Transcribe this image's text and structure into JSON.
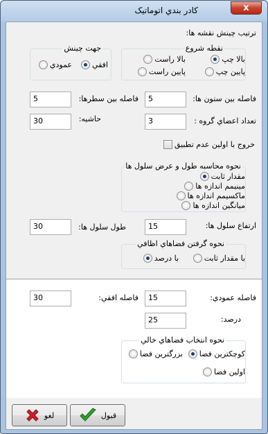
{
  "window": {
    "title": "کادر بندي اتوماتيک",
    "close_label": "x"
  },
  "grid_order": {
    "label": "ترتيب چينش نقشه ها:",
    "start_point": {
      "legend": "نقطه شروع",
      "options": [
        "بالا چپ",
        "بالا راست",
        "پايين چپ",
        "پايين راست"
      ],
      "selected": "بالا چپ"
    },
    "direction": {
      "legend": "جهت چينش",
      "options": [
        "افقي",
        "عمودي"
      ],
      "selected": "افقي"
    }
  },
  "fields": {
    "column_gap_label": "فاصله بين ستون ها:",
    "column_gap_value": "5",
    "row_gap_label": "فاصله بين سطرها:",
    "row_gap_value": "5",
    "group_members_label": "تعداد اعضاي گروه :",
    "group_members_value": "3",
    "margin_label": "حاشيه:",
    "margin_value": "30"
  },
  "exit_checkbox": {
    "label": "خروج با اولين عدم تطبيق",
    "checked": false
  },
  "cell_size": {
    "legend": "نحوه محاسبه طول و عرض سلول ها",
    "options": [
      "مقدار ثابت",
      "مينيمم اندازه ها",
      "ماکسيمم اندازه ها",
      "ميانگين اندازه ها"
    ],
    "selected": "مقدار ثابت",
    "height_label": "ارتفاع سلول ها:",
    "height_value": "15",
    "width_label": "طول سلول ها:",
    "width_value": "30"
  },
  "extra_space": {
    "legend": "نحوه گرفتن فضاهاي اظافي",
    "options": [
      "با مقدار ثابت",
      "با درصد"
    ],
    "selected": "با درصد"
  },
  "spacing": {
    "vertical_label": "فاصله عمودي:",
    "vertical_value": "15",
    "horizontal_label": "فاصله افقي:",
    "horizontal_value": "30",
    "percent_label": "درصد:",
    "percent_value": "25"
  },
  "empty_space": {
    "legend": "نحوه انتخاب فضاهاي خالي",
    "options": [
      "کوچکترين فضا",
      "بزرگترين فضا",
      "اولين فضا"
    ],
    "selected": "کوچکترين فضا"
  },
  "buttons": {
    "ok_label": "قبول",
    "cancel_label": "لغو"
  },
  "colors": {
    "ok_icon": "#2e9e2e",
    "cancel_icon": "#d0202a",
    "title_bar": "#b9d1ea"
  }
}
